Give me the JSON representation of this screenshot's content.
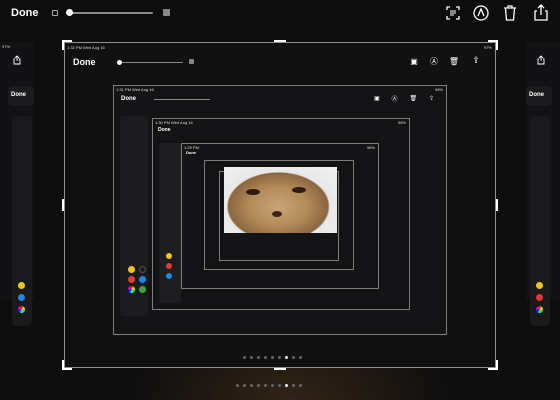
{
  "toolbar": {
    "done_label": "Done",
    "icons": [
      "text-recognition-icon",
      "markup-pen-icon",
      "trash-icon",
      "share-icon"
    ]
  },
  "screenshot_preview": {
    "status_time": "1:32 PM  Wed Aug 16",
    "battery": "97%",
    "done_label": "Done"
  },
  "nested": [
    {
      "time": "1:31 PM  Wed Aug 16",
      "battery": "98%",
      "done": "Done"
    },
    {
      "time": "1:30 PM  Wed Aug 16",
      "battery": "98%",
      "done": "Done"
    },
    {
      "time": "1:29 PM",
      "battery": "98%",
      "done": "Done"
    }
  ],
  "side_preview": {
    "done_label": "Done",
    "battery": "97%"
  },
  "palette_colors": [
    "#f5c518",
    "#1e1e1e",
    "#e53935",
    "#1e88e5",
    "#2e7d32",
    "#9c27b0",
    "#ffffff",
    "#43a047",
    "#cccccc"
  ],
  "page_dots": {
    "count": 9,
    "active": 6
  }
}
